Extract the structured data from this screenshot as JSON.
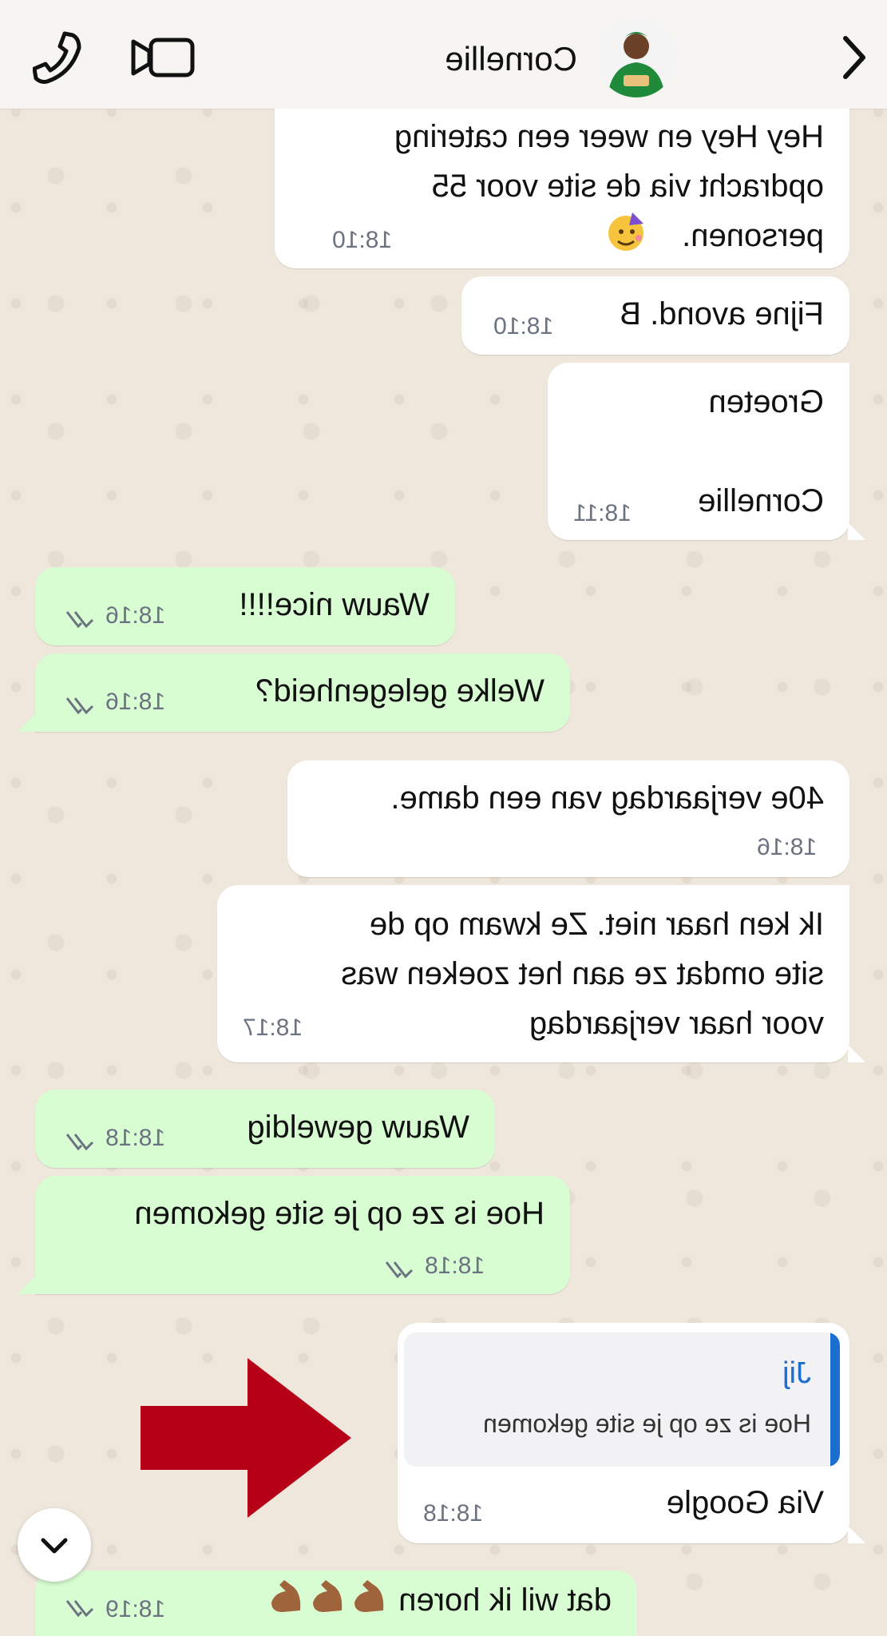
{
  "header": {
    "contact_name": "Cornellie",
    "avatar_icon": "contact-avatar",
    "back_icon": "chevron-left-icon",
    "video_icon": "video-call-icon",
    "call_icon": "phone-icon"
  },
  "messages": [
    {
      "direction": "in",
      "lines": [
        "Hey Hey en weer een catering",
        "opdracht via de site voor 55",
        "personen."
      ],
      "emoji": "partying-face",
      "time": "18:10"
    },
    {
      "direction": "in",
      "lines": [
        "Fijne avond. B"
      ],
      "time": "18:10"
    },
    {
      "direction": "in",
      "lines": [
        "Groeten",
        "",
        "Cornellie"
      ],
      "time": "18:11"
    },
    {
      "direction": "out",
      "lines": [
        "Wauw nice!!!!"
      ],
      "time": "18:16",
      "status": "read"
    },
    {
      "direction": "out",
      "lines": [
        "Welke gelegenheid?"
      ],
      "time": "18:16",
      "status": "read"
    },
    {
      "direction": "in",
      "lines": [
        "40e verjaardag van een dame."
      ],
      "time": "18:16"
    },
    {
      "direction": "in",
      "lines": [
        "Ik ken haar niet. Ze kwam op de",
        "site omdat ze aan het zoeken was",
        "voor haar verjaardag"
      ],
      "time": "18:17"
    },
    {
      "direction": "out",
      "lines": [
        "Wauw geweldig"
      ],
      "time": "18:18",
      "status": "read"
    },
    {
      "direction": "out",
      "lines": [
        "Hoe is ze op je site gekomen"
      ],
      "time": "18:18",
      "status": "read"
    },
    {
      "direction": "in",
      "quote": {
        "author": "Jij",
        "text": "Hoe is ze op je site gekomen"
      },
      "lines": [
        "Via Google"
      ],
      "time": "18:18"
    },
    {
      "direction": "out",
      "lines": [
        "dat wil ik horen"
      ],
      "emoji": "flexed-biceps x3",
      "time": "18:19",
      "status": "read"
    }
  ],
  "annotation": {
    "type": "red-arrow",
    "color": "#b50018"
  },
  "scroll_button_icon": "chevron-down-icon",
  "colors": {
    "incoming": "#ffffff",
    "outgoing": "#d8fdd2",
    "accent": "#1b6fd0",
    "arrow": "#b50018"
  }
}
